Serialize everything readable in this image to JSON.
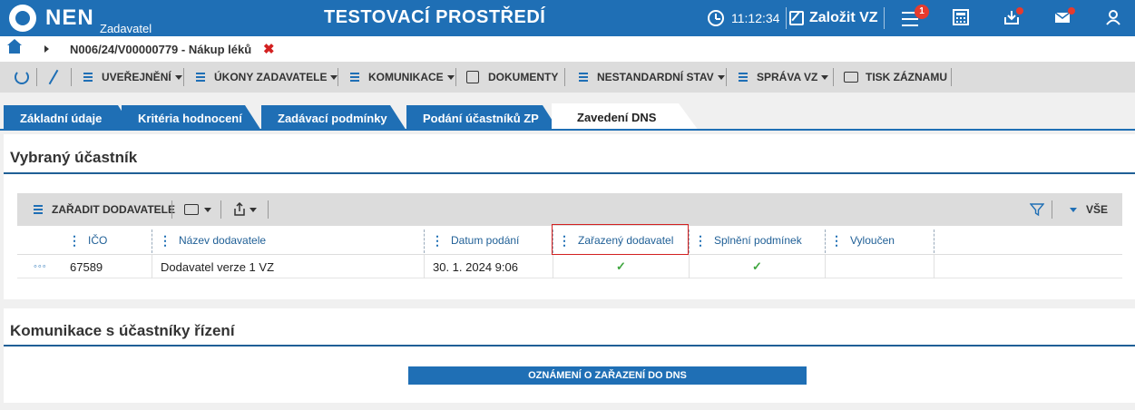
{
  "header": {
    "brand": "NEN",
    "brand_sub": "Zadavatel",
    "env_title": "TESTOVACÍ PROSTŘEDÍ",
    "time": "11:12:34",
    "create_label": "Založit VZ",
    "notification_count": "1",
    "accent_color": "#1f6fb5"
  },
  "breadcrumb": {
    "path": "N006/24/V00000779 - Nákup léků",
    "close_glyph": "✖"
  },
  "toolbar": {
    "items": [
      "UVEŘEJNĚNÍ",
      "ÚKONY ZADAVATELE",
      "KOMUNIKACE",
      "DOKUMENTY",
      "NESTANDARDNÍ STAV",
      "SPRÁVA VZ",
      "TISK ZÁZNAMU"
    ]
  },
  "tabs": [
    "Základní údaje",
    "Kritéria hodnocení",
    "Zadávací podmínky",
    "Podání účastníků ZP",
    "Zavedení DNS"
  ],
  "section1": {
    "title": "Vybraný účastník",
    "grid_toolbar": {
      "add_label": "ZAŘADIT DODAVATELE",
      "filter_all": "VŠE"
    },
    "columns": [
      "IČO",
      "Název dodavatele",
      "Datum podání",
      "Zařazený dodavatel",
      "Splnění podmínek",
      "Vyloučen"
    ],
    "rows": [
      {
        "menu": "◦◦◦",
        "ico": "67589",
        "name": "Dodavatel verze 1 VZ",
        "date": "30. 1. 2024 9:06",
        "included": "✓",
        "conditions": "✓",
        "excluded": ""
      }
    ]
  },
  "section2": {
    "title": "Komunikace s účastníky řízení",
    "button": "OZNÁMENÍ O ZAŘAZENÍ DO DNS"
  }
}
